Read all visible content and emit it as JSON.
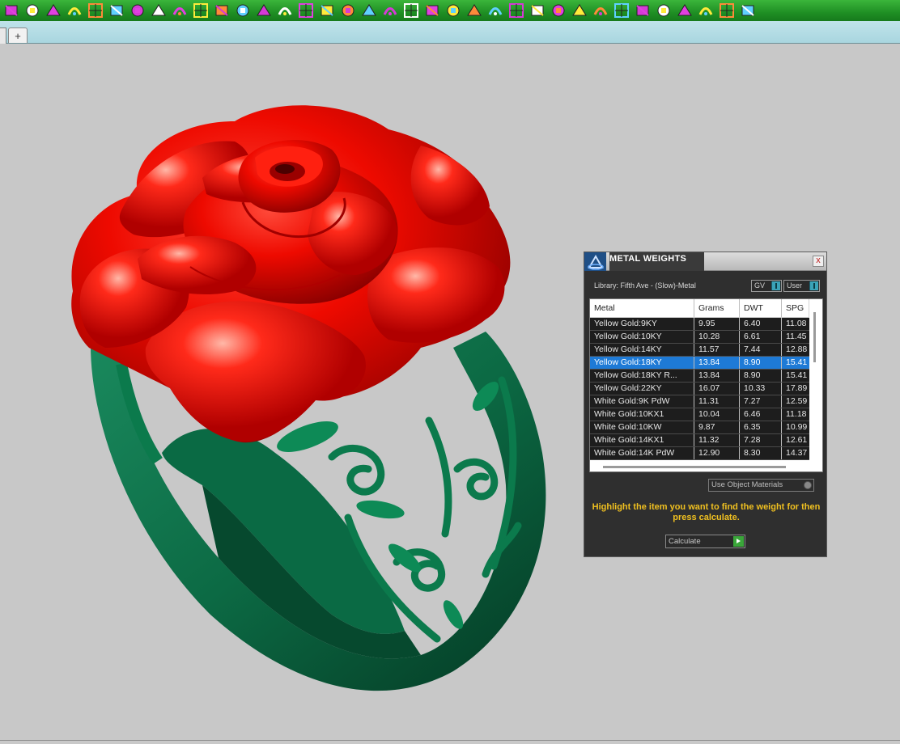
{
  "toolbar": {
    "icons": [
      "curve-icon",
      "points-icon",
      "surface-icon",
      "magnet-icon",
      "rotate-icon",
      "extrude-icon",
      "panel-icon",
      "box-icon",
      "solid-icon",
      "bend-icon",
      "fence-icon",
      "grid-select-icon",
      "grid-icon",
      "stack-icon",
      "lattice-icon",
      "gem-arrow-icon",
      "gem-flag-icon",
      "arch-icon",
      "twist-icon",
      "ring-icon",
      "dots-grid-icon",
      "arc-icon",
      "cursor-icon",
      "sparkle-icon",
      "branch-icon",
      "checker-icon",
      "lamp-icon",
      "star-icon",
      "pentagon-icon",
      "arrows-up-icon",
      "layers-icon",
      "tiles-icon",
      "mesh-icon",
      "cross-icon",
      "cube-icon",
      "gear-icon"
    ]
  },
  "tabs": {
    "add_label": "+"
  },
  "panel": {
    "title": "METAL WEIGHTS",
    "close_label": "x",
    "library_label": "Library: Fifth Ave - (Slow)-Metal",
    "gv_label": "GV",
    "user_label": "User",
    "columns": [
      "Metal",
      "Grams",
      "DWT",
      "SPG"
    ],
    "rows": [
      {
        "metal": "Yellow Gold:9KY",
        "grams": "9.95",
        "dwt": "6.40",
        "spg": "11.08"
      },
      {
        "metal": "Yellow Gold:10KY",
        "grams": "10.28",
        "dwt": "6.61",
        "spg": "11.45"
      },
      {
        "metal": "Yellow Gold:14KY",
        "grams": "11.57",
        "dwt": "7.44",
        "spg": "12.88"
      },
      {
        "metal": "Yellow Gold:18KY",
        "grams": "13.84",
        "dwt": "8.90",
        "spg": "15.41",
        "selected": true
      },
      {
        "metal": "Yellow Gold:18KY R...",
        "grams": "13.84",
        "dwt": "8.90",
        "spg": "15.41"
      },
      {
        "metal": "Yellow Gold:22KY",
        "grams": "16.07",
        "dwt": "10.33",
        "spg": "17.89"
      },
      {
        "metal": "White Gold:9K PdW",
        "grams": "11.31",
        "dwt": "7.27",
        "spg": "12.59"
      },
      {
        "metal": "White Gold:10KX1",
        "grams": "10.04",
        "dwt": "6.46",
        "spg": "11.18"
      },
      {
        "metal": "White Gold:10KW",
        "grams": "9.87",
        "dwt": "6.35",
        "spg": "10.99"
      },
      {
        "metal": "White Gold:14KX1",
        "grams": "11.32",
        "dwt": "7.28",
        "spg": "12.61"
      },
      {
        "metal": "White Gold:14K PdW",
        "grams": "12.90",
        "dwt": "8.30",
        "spg": "14.37"
      }
    ],
    "use_object_materials": "Use Object Materials",
    "hint": "Highlight the item you want to find the weight for then press calculate.",
    "calculate_label": "Calculate"
  },
  "colors": {
    "toolbar_green": "#1f8f24",
    "tab_strip": "#a9d6df",
    "viewport_bg": "#c8c8c8",
    "rose_red": "#e00000",
    "band_green": "#0b6b45",
    "selection_blue": "#1e7ad6",
    "hint_yellow": "#f0c020"
  }
}
